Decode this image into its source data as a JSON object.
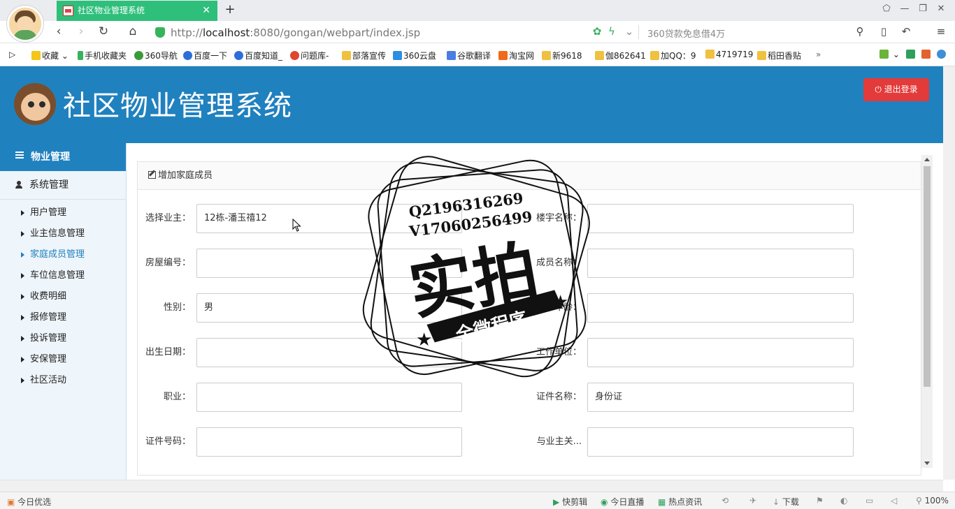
{
  "browser": {
    "tab_title": "社区物业管理系统",
    "url_host": "localhost",
    "url_prefix": "http://",
    "url_rest": ":8080/gongan/webpart/index.jsp",
    "search_suggestion": "360贷款免息借4万",
    "bookmarks": [
      "收藏",
      "手机收藏夹",
      "360导航",
      "百度一下",
      "百度知道_",
      "问题库-",
      "部落宣传",
      "360云盘",
      "谷歌翻译",
      "淘宝网",
      "新9618",
      "伽862641",
      "加QQ：9",
      "4719719",
      "稻田香贴"
    ],
    "status_left": "今日优选",
    "status_items": [
      "快剪辑",
      "今日直播",
      "热点资讯",
      "下载"
    ],
    "zoom": "100%"
  },
  "header": {
    "title": "社区物业管理系统",
    "logout_label": "退出登录"
  },
  "sidebar": {
    "section_property": "物业管理",
    "section_system": "系统管理",
    "items": [
      {
        "label": "用户管理",
        "active": false
      },
      {
        "label": "业主信息管理",
        "active": false
      },
      {
        "label": "家庭成员管理",
        "active": true
      },
      {
        "label": "车位信息管理",
        "active": false
      },
      {
        "label": "收费明细",
        "active": false
      },
      {
        "label": "报修管理",
        "active": false
      },
      {
        "label": "投诉管理",
        "active": false
      },
      {
        "label": "安保管理",
        "active": false
      },
      {
        "label": "社区活动",
        "active": false
      }
    ]
  },
  "form": {
    "title": "增加家庭成员",
    "fields": {
      "owner_label": "选择业主：",
      "owner_value": "12栋-潘玉禧12",
      "building_label": "楼宇名称：",
      "building_value": "",
      "house_no_label": "房屋编号：",
      "house_no_value": "",
      "member_name_label": "成员名称：",
      "member_name_value": "",
      "gender_label": "性别：",
      "gender_value": "男",
      "age_label": "年龄：",
      "age_value": "",
      "birth_label": "出生日期：",
      "birth_value": "",
      "workplace_label": "工作单位：",
      "workplace_value": "",
      "job_label": "职业：",
      "job_value": "",
      "cert_name_label": "证件名称：",
      "cert_name_value": "身份证",
      "cert_no_label": "证件号码：",
      "cert_no_value": "",
      "relation_label": "与业主关...",
      "relation_value": ""
    }
  },
  "watermark": {
    "line1": "Q2196316269",
    "line2": "V17060256499",
    "big": "实拍",
    "banner": "全微程序"
  }
}
